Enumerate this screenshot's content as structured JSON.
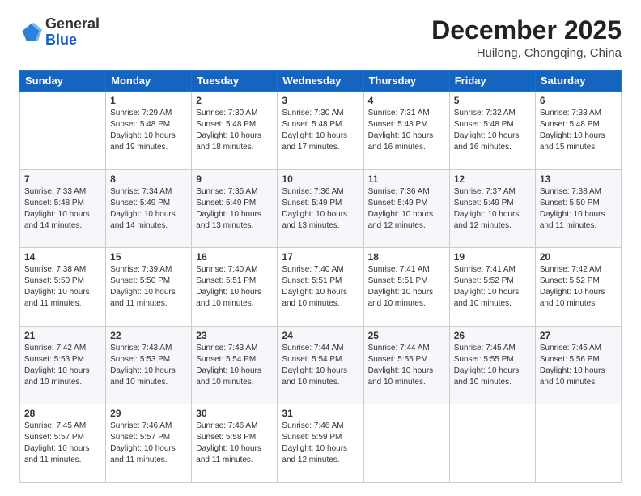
{
  "logo": {
    "general": "General",
    "blue": "Blue"
  },
  "title": "December 2025",
  "subtitle": "Huilong, Chongqing, China",
  "days_of_week": [
    "Sunday",
    "Monday",
    "Tuesday",
    "Wednesday",
    "Thursday",
    "Friday",
    "Saturday"
  ],
  "weeks": [
    [
      {
        "day": "",
        "sunrise": "",
        "sunset": "",
        "daylight": ""
      },
      {
        "day": "1",
        "sunrise": "Sunrise: 7:29 AM",
        "sunset": "Sunset: 5:48 PM",
        "daylight": "Daylight: 10 hours and 19 minutes."
      },
      {
        "day": "2",
        "sunrise": "Sunrise: 7:30 AM",
        "sunset": "Sunset: 5:48 PM",
        "daylight": "Daylight: 10 hours and 18 minutes."
      },
      {
        "day": "3",
        "sunrise": "Sunrise: 7:30 AM",
        "sunset": "Sunset: 5:48 PM",
        "daylight": "Daylight: 10 hours and 17 minutes."
      },
      {
        "day": "4",
        "sunrise": "Sunrise: 7:31 AM",
        "sunset": "Sunset: 5:48 PM",
        "daylight": "Daylight: 10 hours and 16 minutes."
      },
      {
        "day": "5",
        "sunrise": "Sunrise: 7:32 AM",
        "sunset": "Sunset: 5:48 PM",
        "daylight": "Daylight: 10 hours and 16 minutes."
      },
      {
        "day": "6",
        "sunrise": "Sunrise: 7:33 AM",
        "sunset": "Sunset: 5:48 PM",
        "daylight": "Daylight: 10 hours and 15 minutes."
      }
    ],
    [
      {
        "day": "7",
        "sunrise": "Sunrise: 7:33 AM",
        "sunset": "Sunset: 5:48 PM",
        "daylight": "Daylight: 10 hours and 14 minutes."
      },
      {
        "day": "8",
        "sunrise": "Sunrise: 7:34 AM",
        "sunset": "Sunset: 5:49 PM",
        "daylight": "Daylight: 10 hours and 14 minutes."
      },
      {
        "day": "9",
        "sunrise": "Sunrise: 7:35 AM",
        "sunset": "Sunset: 5:49 PM",
        "daylight": "Daylight: 10 hours and 13 minutes."
      },
      {
        "day": "10",
        "sunrise": "Sunrise: 7:36 AM",
        "sunset": "Sunset: 5:49 PM",
        "daylight": "Daylight: 10 hours and 13 minutes."
      },
      {
        "day": "11",
        "sunrise": "Sunrise: 7:36 AM",
        "sunset": "Sunset: 5:49 PM",
        "daylight": "Daylight: 10 hours and 12 minutes."
      },
      {
        "day": "12",
        "sunrise": "Sunrise: 7:37 AM",
        "sunset": "Sunset: 5:49 PM",
        "daylight": "Daylight: 10 hours and 12 minutes."
      },
      {
        "day": "13",
        "sunrise": "Sunrise: 7:38 AM",
        "sunset": "Sunset: 5:50 PM",
        "daylight": "Daylight: 10 hours and 11 minutes."
      }
    ],
    [
      {
        "day": "14",
        "sunrise": "Sunrise: 7:38 AM",
        "sunset": "Sunset: 5:50 PM",
        "daylight": "Daylight: 10 hours and 11 minutes."
      },
      {
        "day": "15",
        "sunrise": "Sunrise: 7:39 AM",
        "sunset": "Sunset: 5:50 PM",
        "daylight": "Daylight: 10 hours and 11 minutes."
      },
      {
        "day": "16",
        "sunrise": "Sunrise: 7:40 AM",
        "sunset": "Sunset: 5:51 PM",
        "daylight": "Daylight: 10 hours and 10 minutes."
      },
      {
        "day": "17",
        "sunrise": "Sunrise: 7:40 AM",
        "sunset": "Sunset: 5:51 PM",
        "daylight": "Daylight: 10 hours and 10 minutes."
      },
      {
        "day": "18",
        "sunrise": "Sunrise: 7:41 AM",
        "sunset": "Sunset: 5:51 PM",
        "daylight": "Daylight: 10 hours and 10 minutes."
      },
      {
        "day": "19",
        "sunrise": "Sunrise: 7:41 AM",
        "sunset": "Sunset: 5:52 PM",
        "daylight": "Daylight: 10 hours and 10 minutes."
      },
      {
        "day": "20",
        "sunrise": "Sunrise: 7:42 AM",
        "sunset": "Sunset: 5:52 PM",
        "daylight": "Daylight: 10 hours and 10 minutes."
      }
    ],
    [
      {
        "day": "21",
        "sunrise": "Sunrise: 7:42 AM",
        "sunset": "Sunset: 5:53 PM",
        "daylight": "Daylight: 10 hours and 10 minutes."
      },
      {
        "day": "22",
        "sunrise": "Sunrise: 7:43 AM",
        "sunset": "Sunset: 5:53 PM",
        "daylight": "Daylight: 10 hours and 10 minutes."
      },
      {
        "day": "23",
        "sunrise": "Sunrise: 7:43 AM",
        "sunset": "Sunset: 5:54 PM",
        "daylight": "Daylight: 10 hours and 10 minutes."
      },
      {
        "day": "24",
        "sunrise": "Sunrise: 7:44 AM",
        "sunset": "Sunset: 5:54 PM",
        "daylight": "Daylight: 10 hours and 10 minutes."
      },
      {
        "day": "25",
        "sunrise": "Sunrise: 7:44 AM",
        "sunset": "Sunset: 5:55 PM",
        "daylight": "Daylight: 10 hours and 10 minutes."
      },
      {
        "day": "26",
        "sunrise": "Sunrise: 7:45 AM",
        "sunset": "Sunset: 5:55 PM",
        "daylight": "Daylight: 10 hours and 10 minutes."
      },
      {
        "day": "27",
        "sunrise": "Sunrise: 7:45 AM",
        "sunset": "Sunset: 5:56 PM",
        "daylight": "Daylight: 10 hours and 10 minutes."
      }
    ],
    [
      {
        "day": "28",
        "sunrise": "Sunrise: 7:45 AM",
        "sunset": "Sunset: 5:57 PM",
        "daylight": "Daylight: 10 hours and 11 minutes."
      },
      {
        "day": "29",
        "sunrise": "Sunrise: 7:46 AM",
        "sunset": "Sunset: 5:57 PM",
        "daylight": "Daylight: 10 hours and 11 minutes."
      },
      {
        "day": "30",
        "sunrise": "Sunrise: 7:46 AM",
        "sunset": "Sunset: 5:58 PM",
        "daylight": "Daylight: 10 hours and 11 minutes."
      },
      {
        "day": "31",
        "sunrise": "Sunrise: 7:46 AM",
        "sunset": "Sunset: 5:59 PM",
        "daylight": "Daylight: 10 hours and 12 minutes."
      },
      {
        "day": "",
        "sunrise": "",
        "sunset": "",
        "daylight": ""
      },
      {
        "day": "",
        "sunrise": "",
        "sunset": "",
        "daylight": ""
      },
      {
        "day": "",
        "sunrise": "",
        "sunset": "",
        "daylight": ""
      }
    ]
  ]
}
